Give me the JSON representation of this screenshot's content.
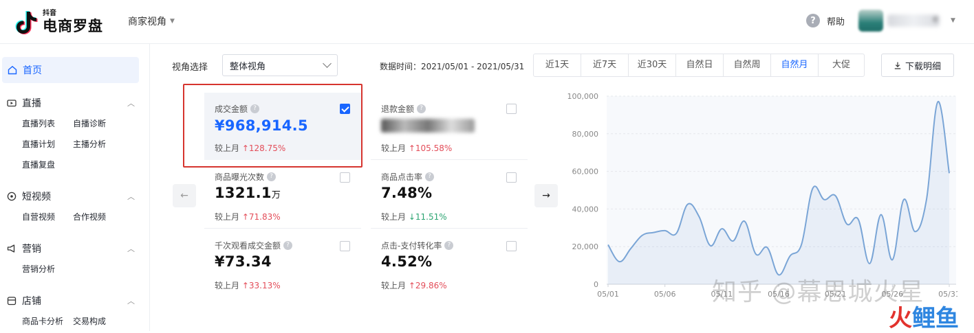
{
  "header": {
    "logo_small": "抖音",
    "logo_big": "电商罗盘",
    "perspective": "商家视角",
    "help": "帮助",
    "username_tail": "e"
  },
  "sidebar": {
    "home": "首页",
    "groups": [
      {
        "label": "直播",
        "items": [
          "直播列表",
          "自播诊断",
          "直播计划",
          "主播分析",
          "直播复盘"
        ]
      },
      {
        "label": "短视频",
        "items": [
          "自营视频",
          "合作视频"
        ]
      },
      {
        "label": "营销",
        "items": [
          "营销分析"
        ]
      },
      {
        "label": "店铺",
        "items": [
          "商品卡分析",
          "交易构成"
        ]
      }
    ]
  },
  "toolbar": {
    "view_label": "视角选择",
    "view_value": "整体视角",
    "datetime": "数据时间：2021/05/01 - 2021/05/31",
    "ranges": [
      "近1天",
      "近7天",
      "近30天",
      "自然日",
      "自然周",
      "自然月",
      "大促"
    ],
    "active_range": "自然月",
    "download": "下载明细"
  },
  "metrics": [
    {
      "title": "成交金额",
      "value": "¥968,914.5",
      "unit": "",
      "cmp_label": "较上月",
      "cmp_dir": "up",
      "cmp_value": "128.75%",
      "checked": true
    },
    {
      "title": "退款金额",
      "value": "",
      "unit": "",
      "cmp_label": "较上月",
      "cmp_dir": "up",
      "cmp_value": "105.58%",
      "checked": false,
      "blurred": true
    },
    {
      "title": "商品曝光次数",
      "value": "1321.1",
      "unit": "万",
      "cmp_label": "较上月",
      "cmp_dir": "up",
      "cmp_value": "71.83%",
      "checked": false
    },
    {
      "title": "商品点击率",
      "value": "7.48%",
      "unit": "",
      "cmp_label": "较上月",
      "cmp_dir": "down",
      "cmp_value": "11.51%",
      "checked": false
    },
    {
      "title": "千次观看成交金额",
      "value": "¥73.34",
      "unit": "",
      "cmp_label": "较上月",
      "cmp_dir": "up",
      "cmp_value": "33.13%",
      "checked": false
    },
    {
      "title": "点击-支付转化率",
      "value": "4.52%",
      "unit": "",
      "cmp_label": "较上月",
      "cmp_dir": "up",
      "cmp_value": "29.86%",
      "checked": false
    }
  ],
  "colors": {
    "accent": "#1966ff",
    "up": "#e34d59",
    "down": "#2ba471",
    "line": "#7aa5d6",
    "highlight": "#d6342e"
  },
  "watermark": {
    "text1": "知乎 @幕思城火星",
    "text2_a": "火",
    "text2_b": "鲤鱼"
  },
  "chart_data": {
    "type": "line",
    "ylim": [
      0,
      100000
    ],
    "yticks": [
      "0",
      "20,000",
      "40,000",
      "60,000",
      "80,000",
      "100,000"
    ],
    "xtick_labels": [
      "05/01",
      "05/06",
      "05/11",
      "05/16",
      "05/21",
      "05/26",
      "05/31"
    ],
    "x": [
      "05/01",
      "05/02",
      "05/03",
      "05/04",
      "05/05",
      "05/06",
      "05/07",
      "05/08",
      "05/09",
      "05/10",
      "05/11",
      "05/12",
      "05/13",
      "05/14",
      "05/15",
      "05/16",
      "05/17",
      "05/18",
      "05/19",
      "05/20",
      "05/21",
      "05/22",
      "05/23",
      "05/24",
      "05/25",
      "05/26",
      "05/27",
      "05/28",
      "05/29",
      "05/30",
      "05/31"
    ],
    "series": [
      {
        "values": [
          21000,
          12000,
          19000,
          26000,
          27500,
          28500,
          27000,
          42500,
          36000,
          20500,
          29500,
          23000,
          33500,
          16000,
          19500,
          5000,
          15000,
          21000,
          51000,
          45000,
          47000,
          32000,
          34500,
          11000,
          37000,
          13000,
          45000,
          28000,
          45000,
          97000,
          59000
        ]
      }
    ]
  }
}
